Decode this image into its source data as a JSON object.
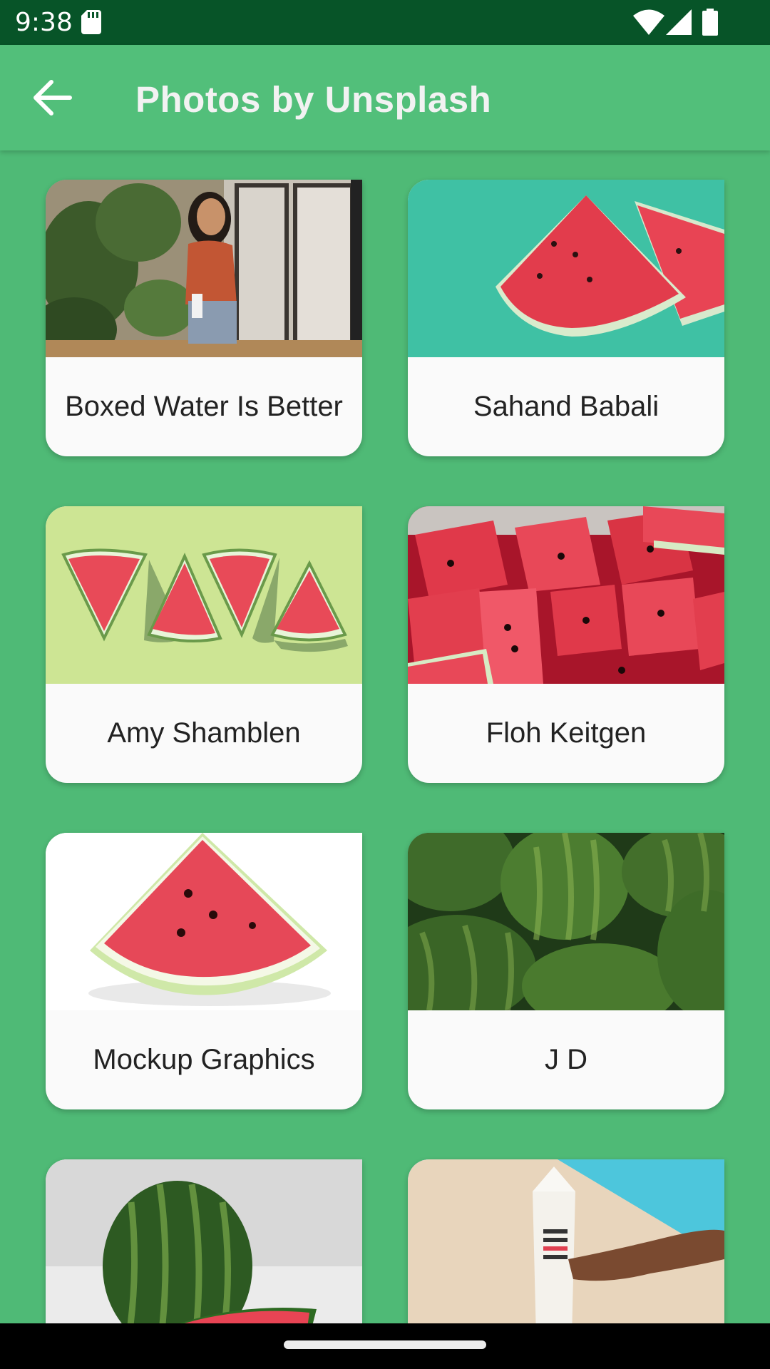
{
  "status_bar": {
    "time": "9:38",
    "icons": [
      "sd-card-icon",
      "wifi-icon",
      "signal-icon",
      "battery-icon"
    ]
  },
  "app_bar": {
    "title": "Photos by Unsplash",
    "back_icon": "arrow-back-icon"
  },
  "photos": [
    {
      "author": "Boxed Water Is Better",
      "image": "woman-holding-boxed-water-by-window"
    },
    {
      "author": "Sahand Babali",
      "image": "watermelon-slices-on-teal"
    },
    {
      "author": "Amy Shamblen",
      "image": "four-watermelon-slices-on-light-green"
    },
    {
      "author": "Floh Keitgen",
      "image": "cubed-watermelon-pile"
    },
    {
      "author": "Mockup Graphics",
      "image": "single-watermelon-slice-on-white"
    },
    {
      "author": "J D",
      "image": "pile-of-whole-watermelons"
    },
    {
      "author": "",
      "image": "whole-watermelon-and-slice-on-gray"
    },
    {
      "author": "",
      "image": "hand-holding-boxed-water-by-pool"
    }
  ],
  "colors": {
    "status_bar": "#075428",
    "app_bar": "#52bf7a",
    "background": "#4fba76",
    "card": "#fafafa"
  }
}
